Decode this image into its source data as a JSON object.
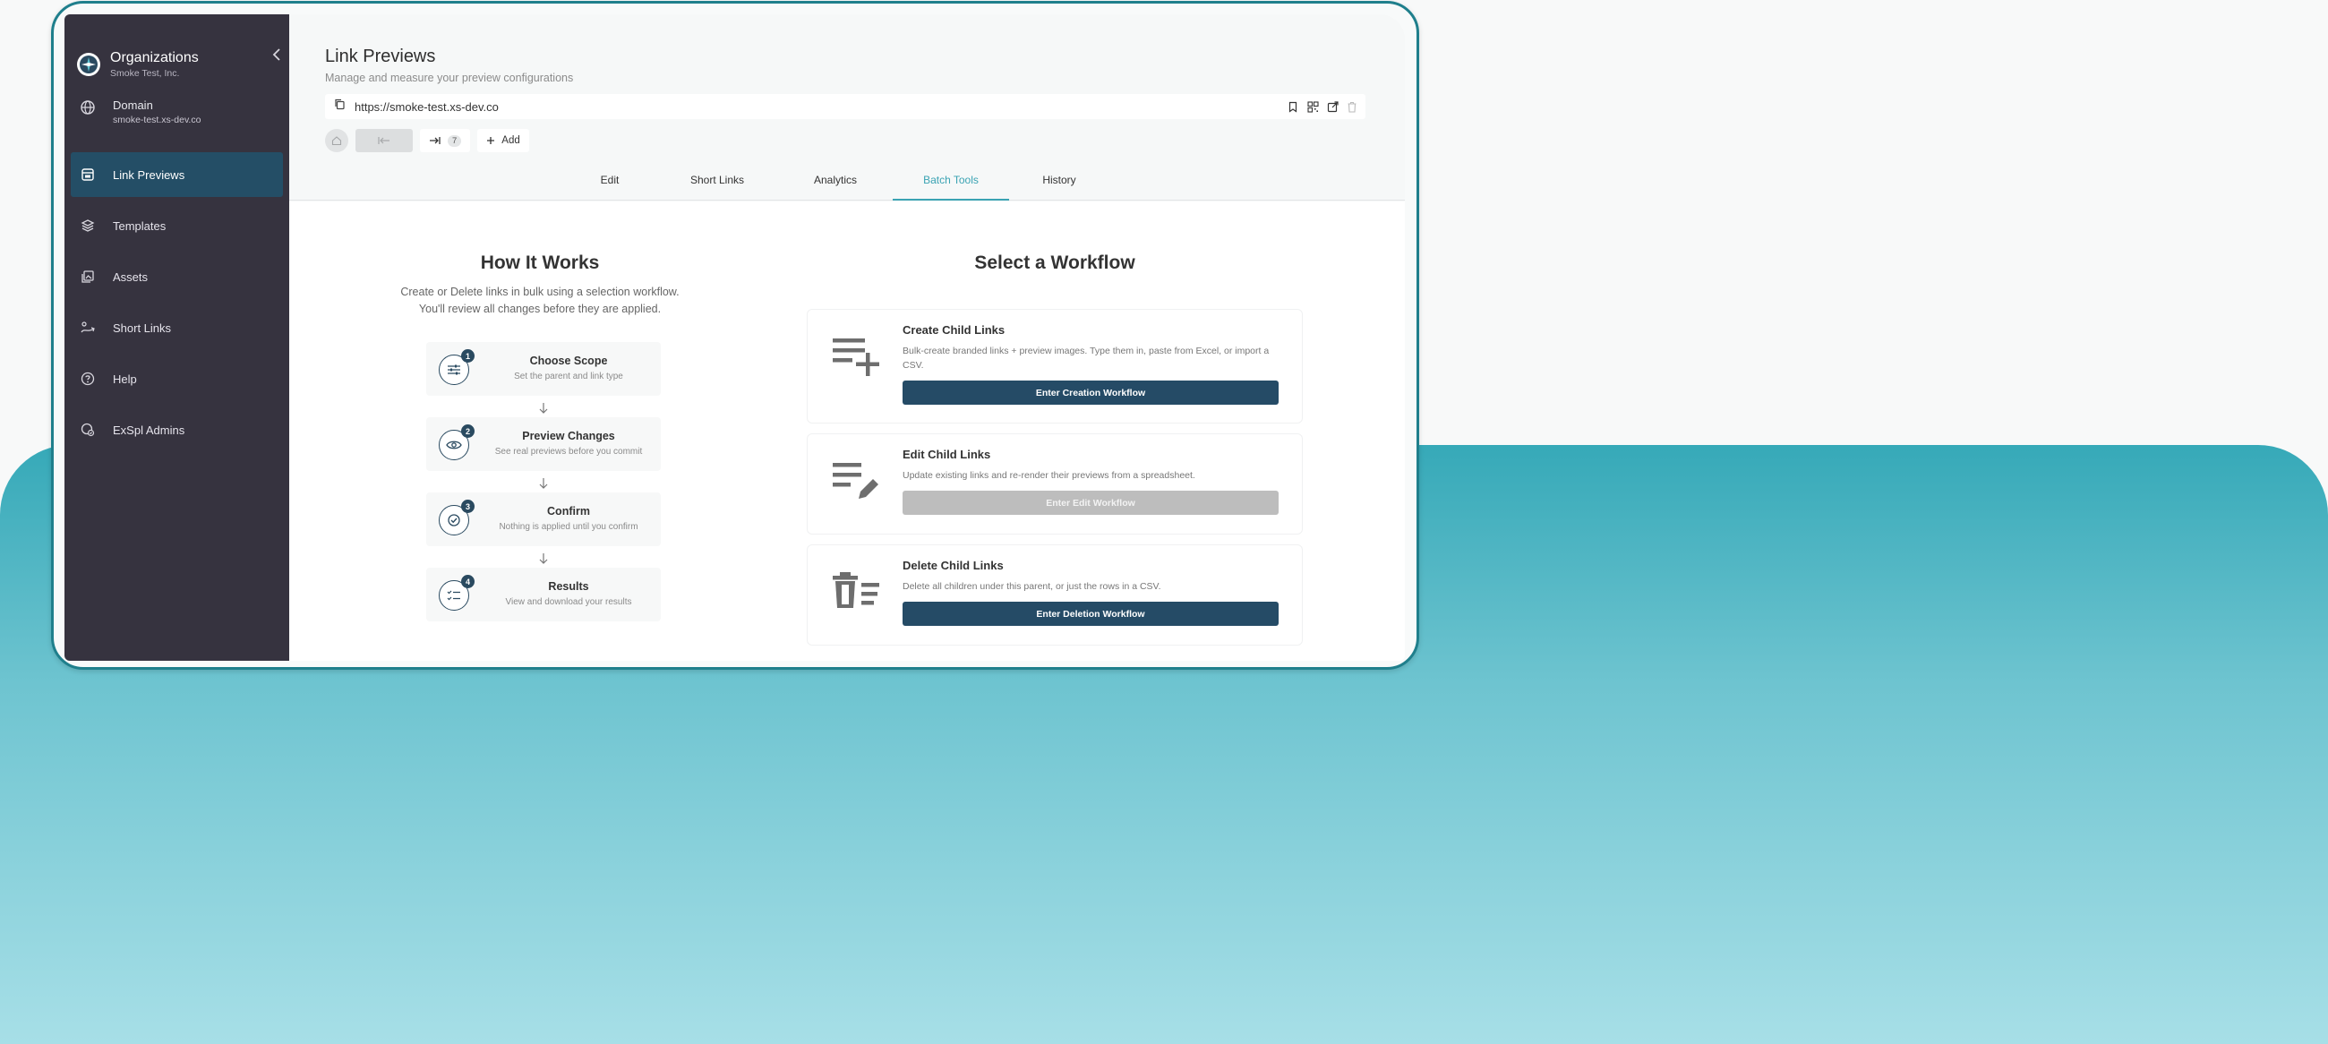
{
  "sidebar": {
    "org_name": "Organizations",
    "org_sub": "Smoke Test, Inc.",
    "domain_title": "Domain",
    "domain_sub": "smoke-test.xs-dev.co",
    "items": [
      {
        "label": "Link Previews",
        "icon": "link-preview-icon"
      },
      {
        "label": "Templates",
        "icon": "layers-icon"
      },
      {
        "label": "Assets",
        "icon": "images-icon"
      },
      {
        "label": "Short Links",
        "icon": "short-link-icon"
      },
      {
        "label": "Help",
        "icon": "help-icon"
      },
      {
        "label": "ExSpl Admins",
        "icon": "admin-icon"
      }
    ],
    "active_index": 0
  },
  "header": {
    "title": "Link Previews",
    "subtitle": "Manage and measure your preview configurations"
  },
  "url_bar": {
    "value": "https://smoke-test.xs-dev.co"
  },
  "toolbar": {
    "children_count": "7",
    "add_label": "Add"
  },
  "tabs": [
    {
      "label": "Edit"
    },
    {
      "label": "Short Links"
    },
    {
      "label": "Analytics"
    },
    {
      "label": "Batch Tools"
    },
    {
      "label": "History"
    }
  ],
  "active_tab": 3,
  "how_it_works": {
    "title": "How It Works",
    "desc_line1": "Create or Delete links in bulk using a selection workflow.",
    "desc_line2": "You'll review all changes before they are applied.",
    "steps": [
      {
        "num": "1",
        "title": "Choose Scope",
        "sub": "Set the parent and link type"
      },
      {
        "num": "2",
        "title": "Preview Changes",
        "sub": "See real previews before you commit"
      },
      {
        "num": "3",
        "title": "Confirm",
        "sub": "Nothing is applied until you confirm"
      },
      {
        "num": "4",
        "title": "Results",
        "sub": "View and download your results"
      }
    ]
  },
  "workflow": {
    "title": "Select a Workflow",
    "cards": [
      {
        "title": "Create Child Links",
        "desc": "Bulk-create branded links + preview images. Type them in, paste from Excel, or import a CSV.",
        "button": "Enter Creation Workflow"
      },
      {
        "title": "Edit Child Links",
        "desc": "Update existing links and re-render their previews from a spreadsheet.",
        "button": "Enter Edit Workflow"
      },
      {
        "title": "Delete Child Links",
        "desc": "Delete all children under this parent, or just the rows in a CSV.",
        "button": "Enter Deletion Workflow"
      }
    ]
  },
  "colors": {
    "sidebar_bg": "#36333f",
    "active_nav": "#244e66",
    "accent": "#3aa3b3",
    "primary_button": "#254b66",
    "disabled_button": "#bdbdbd",
    "frame": "#1f7f8c"
  }
}
